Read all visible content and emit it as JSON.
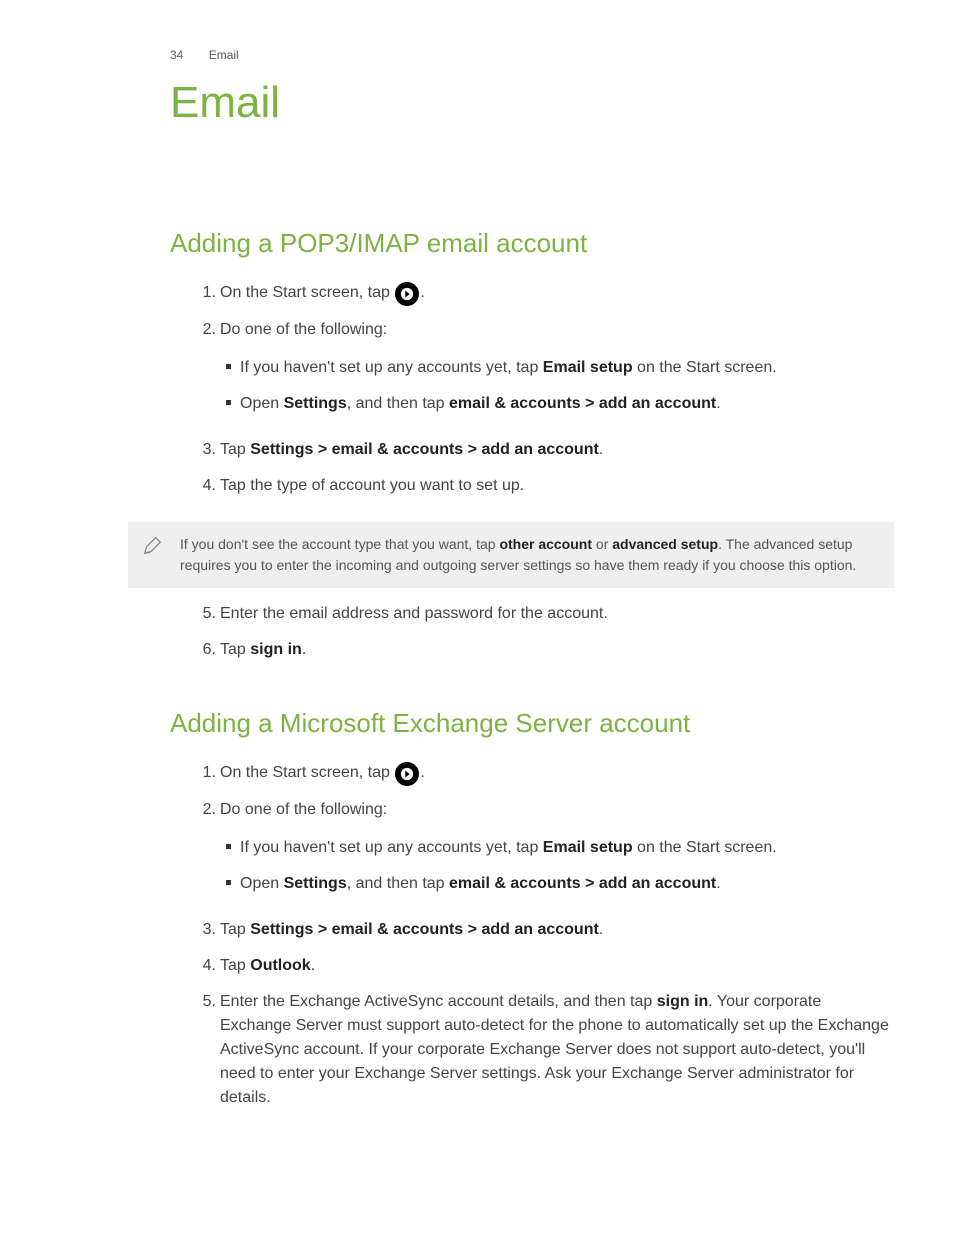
{
  "header": {
    "page_number": "34",
    "crumb": "Email"
  },
  "title_h1": "Email",
  "section1": {
    "heading": "Adding a POP3/IMAP email account",
    "step1_pre": "On the Start screen, tap ",
    "step1_post": ".",
    "step2": "Do one of the following:",
    "sub1a_pre": "If you haven't set up any accounts yet, tap ",
    "sub1a_bold": "Email setup",
    "sub1a_post": " on the Start screen.",
    "sub1b_pre": "Open ",
    "sub1b_bold1": "Settings",
    "sub1b_mid": ", and then tap ",
    "sub1b_bold2": "email & accounts > add an account",
    "sub1b_post": ".",
    "step3_pre": "Tap ",
    "step3_bold": "Settings > email & accounts > add an account",
    "step3_post": ".",
    "step4": "Tap the type of account you want to set up.",
    "note_pre": "If you don't see the account type that you want, tap ",
    "note_b1": "other account",
    "note_mid": " or ",
    "note_b2": "advanced setup",
    "note_post": ". The advanced setup requires you to enter the incoming and outgoing server settings so have them ready if you choose this option.",
    "step5": "Enter the email address and password for the account.",
    "step6_pre": "Tap ",
    "step6_bold": "sign in",
    "step6_post": "."
  },
  "section2": {
    "heading": "Adding a Microsoft Exchange Server account",
    "step1_pre": "On the Start screen, tap ",
    "step1_post": ".",
    "step2": "Do one of the following:",
    "sub2a_pre": "If you haven't set up any accounts yet, tap ",
    "sub2a_bold": "Email setup",
    "sub2a_post": " on the Start screen.",
    "sub2b_pre": "Open ",
    "sub2b_bold1": "Settings",
    "sub2b_mid": ", and then tap ",
    "sub2b_bold2": "email & accounts > add an account",
    "sub2b_post": ".",
    "step3_pre": "Tap ",
    "step3_bold": "Settings > email & accounts > add an account",
    "step3_post": ".",
    "step4_pre": "Tap ",
    "step4_bold": "Outlook",
    "step4_post": ".",
    "step5_pre": "Enter the Exchange ActiveSync account details, and then tap ",
    "step5_bold": "sign in",
    "step5_post": ". Your corporate Exchange Server must support auto-detect for the phone to automatically set up the Exchange ActiveSync account. If your corporate Exchange Server does not support auto-detect, you'll need to enter your Exchange Server settings. Ask your Exchange Server administrator for details."
  }
}
